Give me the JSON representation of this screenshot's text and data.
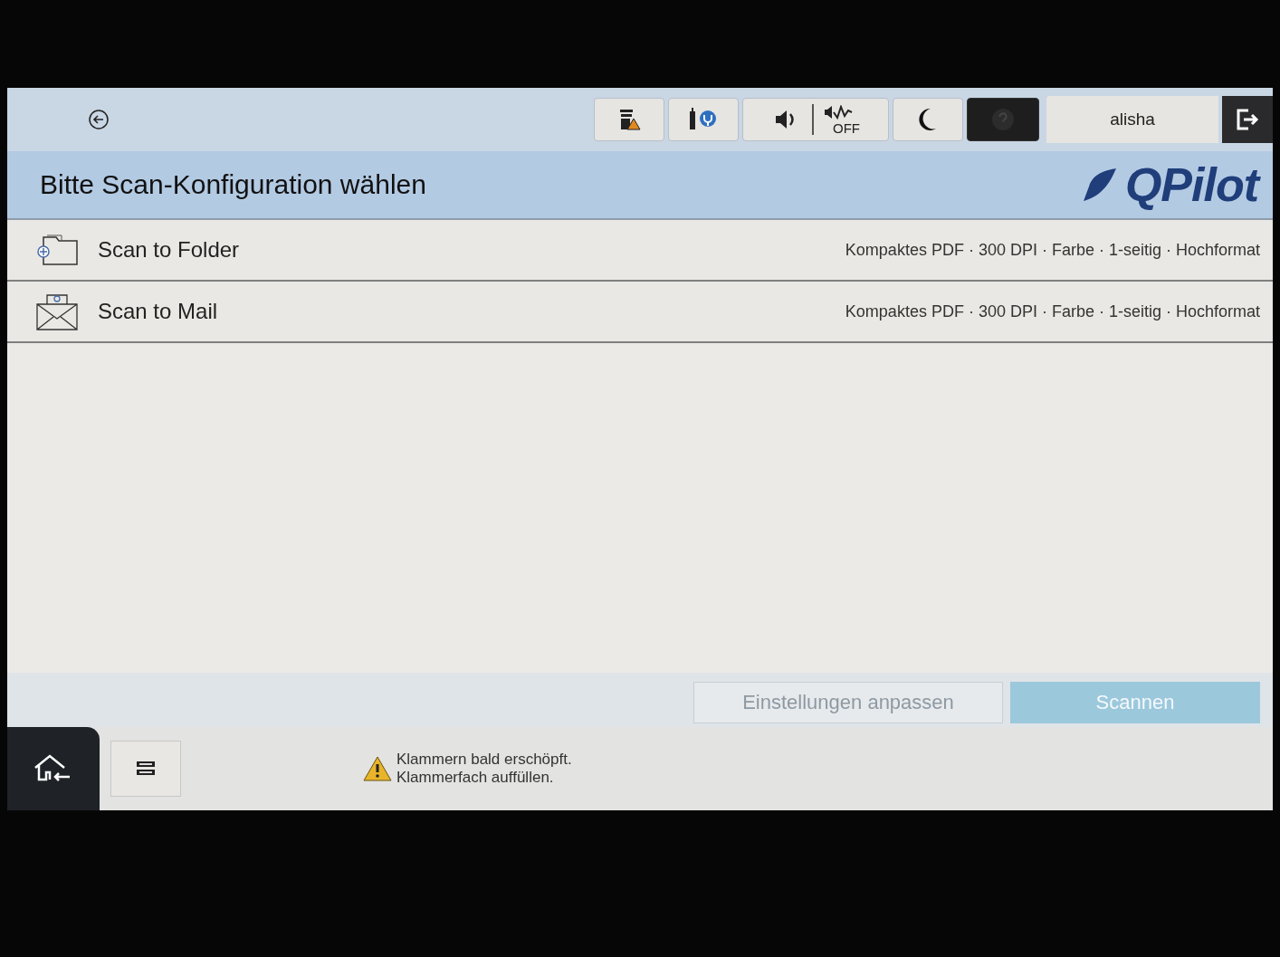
{
  "header": {
    "title": "Bitte Scan-Konfiguration wählen",
    "logo": "QPilot"
  },
  "sound_off_button": {
    "label": "OFF"
  },
  "help_button": {
    "disabled": true
  },
  "user": {
    "name": "alisha"
  },
  "configurations": [
    {
      "kind": "folder",
      "name": "Scan to Folder",
      "settings": "Kompaktes PDF · 300 DPI · Farbe · 1-seitig · Hochformat"
    },
    {
      "kind": "mail",
      "name": "Scan to Mail",
      "settings": "Kompaktes PDF · 300 DPI · Farbe · 1-seitig · Hochformat"
    }
  ],
  "actions": [
    {
      "kind": "secondary",
      "label": "Einstellungen anpassen",
      "disabled": true
    },
    {
      "kind": "primary",
      "label": "Scannen",
      "disabled": true
    }
  ],
  "notification": {
    "lines": [
      "Klammern bald erschöpft.",
      "Klammerfach auffüllen."
    ]
  }
}
